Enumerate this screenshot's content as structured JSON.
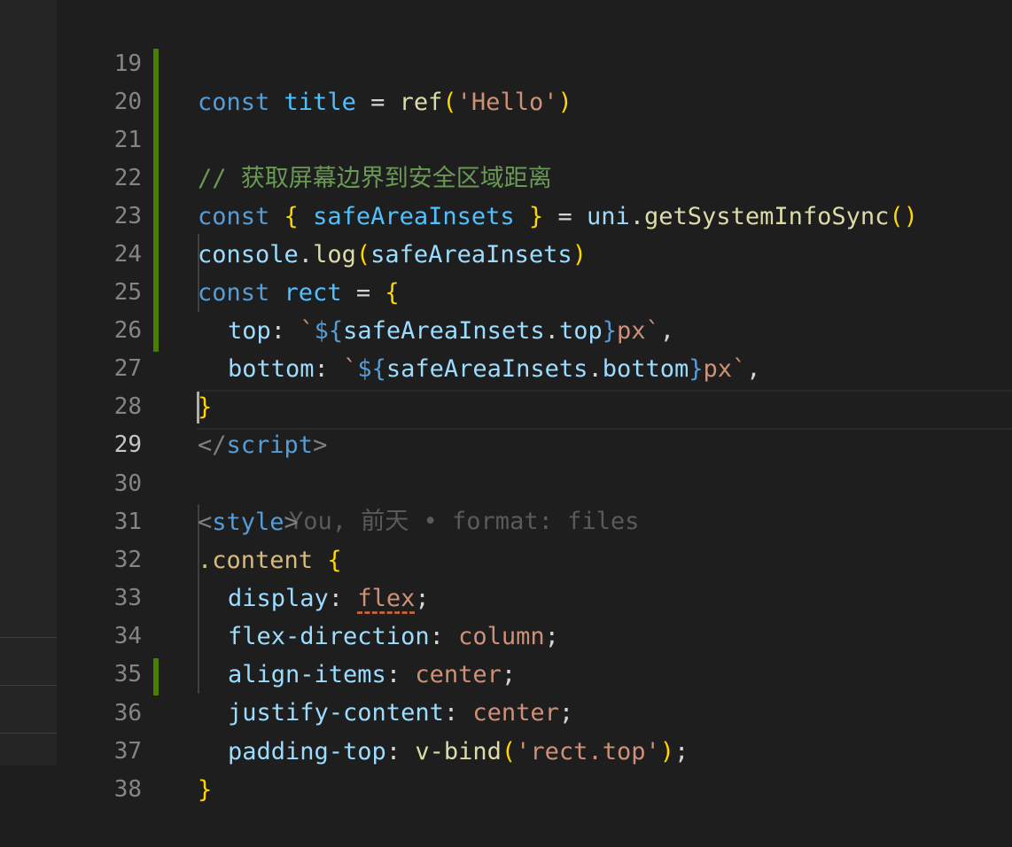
{
  "editor": {
    "lines": [
      {
        "num": "19",
        "tokens": [
          "const",
          "title",
          "=",
          "ref",
          "(",
          "'Hello'",
          ")"
        ]
      },
      {
        "num": "20",
        "tokens": []
      },
      {
        "num": "21",
        "tokens": [
          "// 获取屏幕边界到安全区域距离"
        ]
      },
      {
        "num": "22",
        "tokens": [
          "const",
          "{",
          "safeAreaInsets",
          "}",
          "=",
          "uni",
          ".",
          "getSystemInfoSync",
          "(",
          ")"
        ]
      },
      {
        "num": "23",
        "tokens": [
          "console",
          ".",
          "log",
          "(",
          "safeAreaInsets",
          ")"
        ]
      },
      {
        "num": "24",
        "tokens": [
          "const",
          "rect",
          "=",
          "{"
        ]
      },
      {
        "num": "25",
        "tokens": [
          "top",
          ":",
          "`",
          "${",
          "safeAreaInsets",
          ".",
          "top",
          "}",
          "px`",
          ","
        ]
      },
      {
        "num": "26",
        "tokens": [
          "bottom",
          ":",
          "`",
          "${",
          "safeAreaInsets",
          ".",
          "bottom",
          "}",
          "px`",
          ","
        ]
      },
      {
        "num": "27",
        "tokens": [
          "}"
        ]
      },
      {
        "num": "28",
        "tokens": [
          "</",
          "script",
          ">"
        ]
      },
      {
        "num": "29",
        "blame": "You, 前天 • format: files"
      },
      {
        "num": "30",
        "tokens": [
          "<",
          "style",
          ">"
        ]
      },
      {
        "num": "31",
        "tokens": [
          ".content",
          "{"
        ]
      },
      {
        "num": "32",
        "tokens": [
          "display",
          ":",
          "flex",
          ";"
        ]
      },
      {
        "num": "33",
        "tokens": [
          "flex-direction",
          ":",
          "column",
          ";"
        ]
      },
      {
        "num": "34",
        "tokens": [
          "align-items",
          ":",
          "center",
          ";"
        ]
      },
      {
        "num": "35",
        "tokens": [
          "justify-content",
          ":",
          "center",
          ";"
        ]
      },
      {
        "num": "36",
        "tokens": [
          "padding-top",
          ":",
          "v-bind",
          "(",
          "'rect.top'",
          ")",
          ";"
        ]
      },
      {
        "num": "37",
        "tokens": [
          "}"
        ]
      },
      {
        "num": "38",
        "tokens": []
      }
    ],
    "active_line": "29"
  },
  "colors": {
    "background": "#1e1e1e",
    "git_modified": "#487e02",
    "keyword": "#569cd6",
    "variable": "#9cdcfe",
    "function": "#dcdcaa",
    "string": "#ce9178",
    "comment": "#6a9955"
  }
}
